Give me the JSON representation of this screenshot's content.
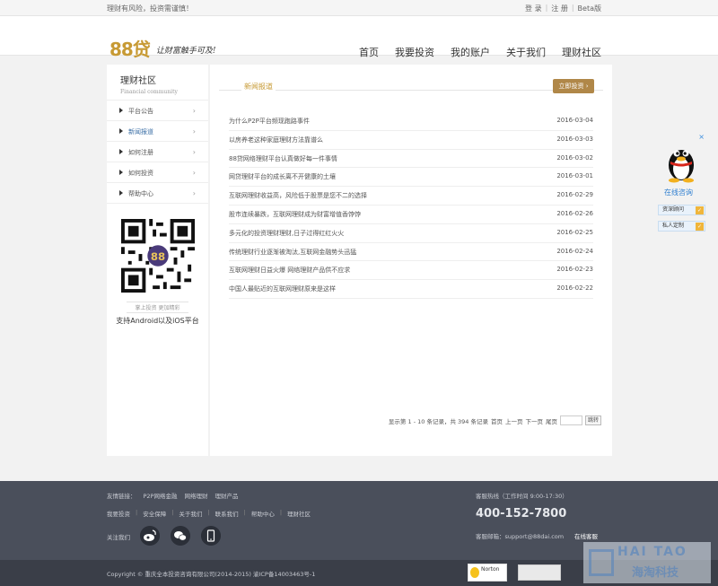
{
  "topbar": {
    "warning": "理财有风险，投资需谨慎！",
    "login": "登 录",
    "register": "注 册",
    "beta": "Beta版",
    "sep": "|"
  },
  "header": {
    "logo_text": "88贷",
    "slogan": "让财富触手可及!",
    "nav": [
      "首页",
      "我要投资",
      "我的账户",
      "关于我们",
      "理财社区"
    ]
  },
  "sidebar": {
    "title": "理财社区",
    "subtitle": "Financial community",
    "items": [
      "平台公告",
      "新闻报道",
      "如何注册",
      "如何投资",
      "帮助中心"
    ],
    "active_index": 1,
    "qr_caption_small": "掌上投资 更加精彩",
    "qr_caption": "支持Android以及iOS平台"
  },
  "content": {
    "section_title": "新闻报道",
    "invest_button": "立即投资 ›",
    "news": [
      {
        "title": "为什么P2P平台频现跑路事件",
        "date": "2016-03-04"
      },
      {
        "title": "以房养老这种家庭理财方法靠谱么",
        "date": "2016-03-03"
      },
      {
        "title": "88贷网络理财平台认真做好每一件事情",
        "date": "2016-03-02"
      },
      {
        "title": "网贷理财平台的成长离不开健康的土壤",
        "date": "2016-03-01"
      },
      {
        "title": "互联网理财收益高，风险低于股票是您不二的选择",
        "date": "2016-02-29"
      },
      {
        "title": "股市连续暴跌，互联网理财成为财富增值香饽饽",
        "date": "2016-02-26"
      },
      {
        "title": "多元化的投资理财理财,日子过得红红火火",
        "date": "2016-02-25"
      },
      {
        "title": "传统理财行业逐渐被淘汰,互联网金融势头迅猛",
        "date": "2016-02-24"
      },
      {
        "title": "互联网理财日益火爆 网络理财产品供不应求",
        "date": "2016-02-23"
      },
      {
        "title": "中国人最贴近的互联网理财原来是这样",
        "date": "2016-02-22"
      }
    ],
    "pager": {
      "summary": "显示第 1 - 10 条记录，共 394 条记录",
      "first": "首页",
      "prev": "上一页",
      "next": "下一页",
      "last": "尾页",
      "go": "跳转"
    }
  },
  "float_service": {
    "close": "×",
    "online": "在线咨询",
    "buttons": [
      "资深顾问",
      "私人定制"
    ],
    "ok": "✓"
  },
  "footer": {
    "friend_links_label": "友情链接：",
    "friend_links": [
      "P2P网络金融",
      "网络理财",
      "理财产品"
    ],
    "links": [
      "我要投资",
      "安全保障",
      "关于我们",
      "联系我们",
      "帮助中心",
      "理财社区"
    ],
    "follow": "关注我们",
    "hotline_label": "客服热线（工作时间 9:00-17:30）",
    "phone": "400-152-7800",
    "email": "客服邮箱：support@88dai.com",
    "online_service": "在线客服",
    "copyright": "Copyright © 重庆全本投资咨询有限公司(2014-2015) 渝ICP备14003463号-1",
    "norton": "Norton"
  },
  "watermark": {
    "line1": "HAI TAO",
    "line2": "海淘科技"
  }
}
